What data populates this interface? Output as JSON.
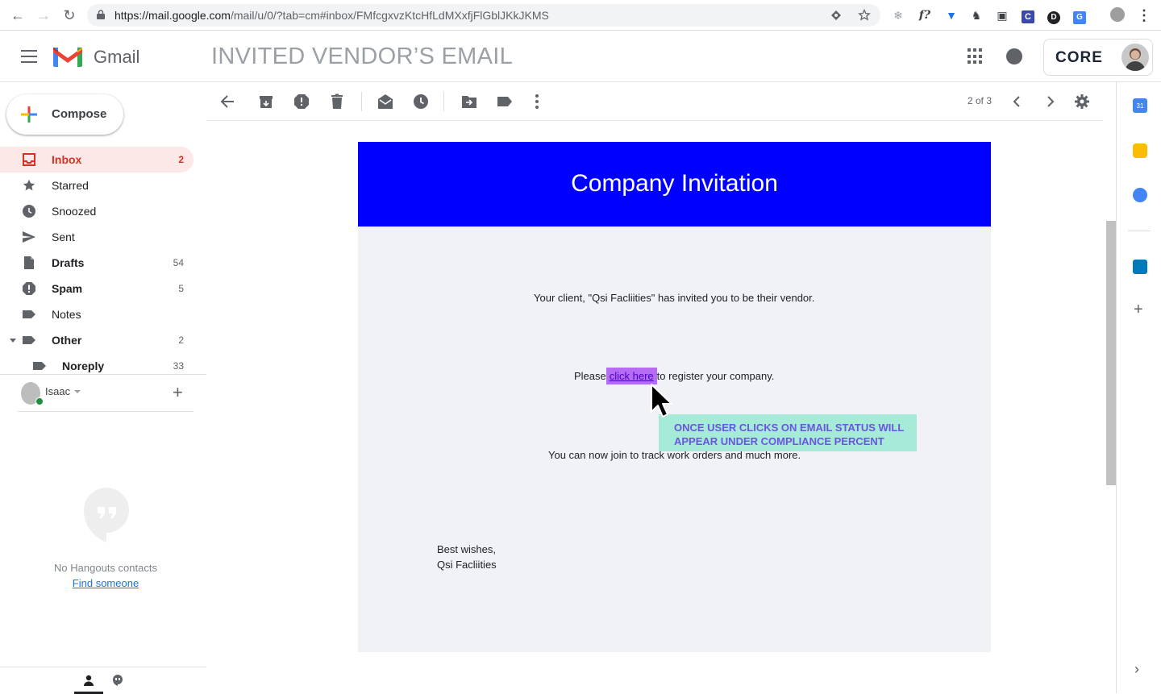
{
  "browser": {
    "url_host": "https://mail.google.com",
    "url_path": "/mail/u/0/?tab=cm#inbox/FMfcgxvzKtcHfLdMXxfjFlGblJKkJKMS"
  },
  "header": {
    "app_name": "Gmail",
    "banner": "INVITED VENDOR’S EMAIL",
    "account_logo": "CORE"
  },
  "compose": {
    "label": "Compose"
  },
  "sidebar": {
    "items": [
      {
        "label": "Inbox",
        "count": "2",
        "icon": "inbox-icon"
      },
      {
        "label": "Starred",
        "count": "",
        "icon": "star-icon"
      },
      {
        "label": "Snoozed",
        "count": "",
        "icon": "clock-icon"
      },
      {
        "label": "Sent",
        "count": "",
        "icon": "send-icon"
      },
      {
        "label": "Drafts",
        "count": "54",
        "icon": "file-icon"
      },
      {
        "label": "Spam",
        "count": "5",
        "icon": "spam-icon"
      },
      {
        "label": "Notes",
        "count": "",
        "icon": "label-icon"
      },
      {
        "label": "Other",
        "count": "2",
        "icon": "label-icon"
      },
      {
        "label": "Noreply",
        "count": "33",
        "icon": "label-icon"
      }
    ]
  },
  "hangouts": {
    "user": "Isaac",
    "empty_text": "No Hangouts contacts",
    "find_link": "Find someone"
  },
  "toolbar": {
    "pager": "2 of 3"
  },
  "email": {
    "title": "Company Invitation",
    "line1": "Your client, \"Qsi Facliities\" has invited you to be their vendor.",
    "line2_pre": "Please",
    "line2_link": "click here",
    "line2_post": "to register your company.",
    "line3": "You can now join to track work orders and much more.",
    "signoff": "Best wishes,",
    "signature": "Qsi Facliities"
  },
  "annotation": {
    "line1": "ONCE USER CLICKS ON EMAIL STATUS WILL",
    "line2": "APPEAR UNDER COMPLIANCE PERCENT"
  },
  "colors": {
    "email_header_bg": "#0000ff",
    "link_highlight": "#b56cf2",
    "callout_bg": "#a6ead8",
    "inbox_active": "#d93025"
  }
}
